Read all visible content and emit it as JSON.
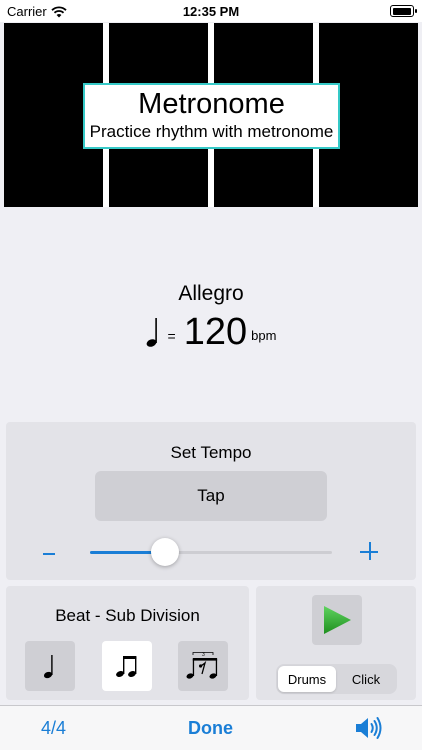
{
  "status_bar": {
    "carrier": "Carrier",
    "time": "12:35 PM"
  },
  "banner": {
    "title": "Metronome",
    "subtitle": "Practice rhythm with metronome"
  },
  "tempo": {
    "name": "Allegro",
    "equals": "=",
    "bpm": "120",
    "unit": "bpm"
  },
  "set_tempo": {
    "title": "Set Tempo",
    "tap_label": "Tap",
    "slider_fraction": 0.31
  },
  "beat": {
    "title": "Beat - Sub Division",
    "options": [
      {
        "icon": "quarter-note-icon",
        "selected": false
      },
      {
        "icon": "eighth-notes-icon",
        "selected": true
      },
      {
        "icon": "triplet-notes-icon",
        "selected": false
      }
    ]
  },
  "sound": {
    "options": [
      "Drums",
      "Click"
    ],
    "selected": "Drums"
  },
  "toolbar": {
    "time_signature": "4/4",
    "done_label": "Done"
  },
  "colors": {
    "accent": "#1a7ed6",
    "banner_border": "#35c9c7",
    "play_green": "#2faa2f"
  }
}
